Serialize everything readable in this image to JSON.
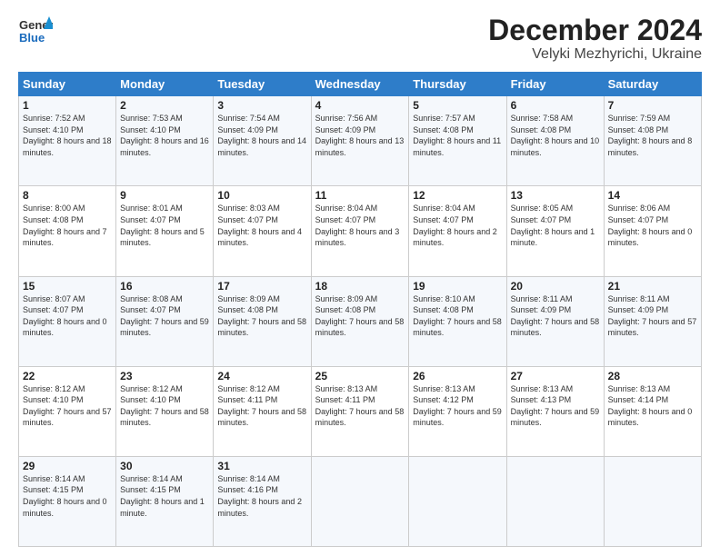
{
  "header": {
    "logo_line1": "General",
    "logo_line2": "Blue",
    "title": "December 2024",
    "subtitle": "Velyki Mezhyrichi, Ukraine"
  },
  "calendar": {
    "days_of_week": [
      "Sunday",
      "Monday",
      "Tuesday",
      "Wednesday",
      "Thursday",
      "Friday",
      "Saturday"
    ],
    "weeks": [
      [
        {
          "day": "1",
          "info": "Sunrise: 7:52 AM\nSunset: 4:10 PM\nDaylight: 8 hours and 18 minutes."
        },
        {
          "day": "2",
          "info": "Sunrise: 7:53 AM\nSunset: 4:10 PM\nDaylight: 8 hours and 16 minutes."
        },
        {
          "day": "3",
          "info": "Sunrise: 7:54 AM\nSunset: 4:09 PM\nDaylight: 8 hours and 14 minutes."
        },
        {
          "day": "4",
          "info": "Sunrise: 7:56 AM\nSunset: 4:09 PM\nDaylight: 8 hours and 13 minutes."
        },
        {
          "day": "5",
          "info": "Sunrise: 7:57 AM\nSunset: 4:08 PM\nDaylight: 8 hours and 11 minutes."
        },
        {
          "day": "6",
          "info": "Sunrise: 7:58 AM\nSunset: 4:08 PM\nDaylight: 8 hours and 10 minutes."
        },
        {
          "day": "7",
          "info": "Sunrise: 7:59 AM\nSunset: 4:08 PM\nDaylight: 8 hours and 8 minutes."
        }
      ],
      [
        {
          "day": "8",
          "info": "Sunrise: 8:00 AM\nSunset: 4:08 PM\nDaylight: 8 hours and 7 minutes."
        },
        {
          "day": "9",
          "info": "Sunrise: 8:01 AM\nSunset: 4:07 PM\nDaylight: 8 hours and 5 minutes."
        },
        {
          "day": "10",
          "info": "Sunrise: 8:03 AM\nSunset: 4:07 PM\nDaylight: 8 hours and 4 minutes."
        },
        {
          "day": "11",
          "info": "Sunrise: 8:04 AM\nSunset: 4:07 PM\nDaylight: 8 hours and 3 minutes."
        },
        {
          "day": "12",
          "info": "Sunrise: 8:04 AM\nSunset: 4:07 PM\nDaylight: 8 hours and 2 minutes."
        },
        {
          "day": "13",
          "info": "Sunrise: 8:05 AM\nSunset: 4:07 PM\nDaylight: 8 hours and 1 minute."
        },
        {
          "day": "14",
          "info": "Sunrise: 8:06 AM\nSunset: 4:07 PM\nDaylight: 8 hours and 0 minutes."
        }
      ],
      [
        {
          "day": "15",
          "info": "Sunrise: 8:07 AM\nSunset: 4:07 PM\nDaylight: 8 hours and 0 minutes."
        },
        {
          "day": "16",
          "info": "Sunrise: 8:08 AM\nSunset: 4:07 PM\nDaylight: 7 hours and 59 minutes."
        },
        {
          "day": "17",
          "info": "Sunrise: 8:09 AM\nSunset: 4:08 PM\nDaylight: 7 hours and 58 minutes."
        },
        {
          "day": "18",
          "info": "Sunrise: 8:09 AM\nSunset: 4:08 PM\nDaylight: 7 hours and 58 minutes."
        },
        {
          "day": "19",
          "info": "Sunrise: 8:10 AM\nSunset: 4:08 PM\nDaylight: 7 hours and 58 minutes."
        },
        {
          "day": "20",
          "info": "Sunrise: 8:11 AM\nSunset: 4:09 PM\nDaylight: 7 hours and 58 minutes."
        },
        {
          "day": "21",
          "info": "Sunrise: 8:11 AM\nSunset: 4:09 PM\nDaylight: 7 hours and 57 minutes."
        }
      ],
      [
        {
          "day": "22",
          "info": "Sunrise: 8:12 AM\nSunset: 4:10 PM\nDaylight: 7 hours and 57 minutes."
        },
        {
          "day": "23",
          "info": "Sunrise: 8:12 AM\nSunset: 4:10 PM\nDaylight: 7 hours and 58 minutes."
        },
        {
          "day": "24",
          "info": "Sunrise: 8:12 AM\nSunset: 4:11 PM\nDaylight: 7 hours and 58 minutes."
        },
        {
          "day": "25",
          "info": "Sunrise: 8:13 AM\nSunset: 4:11 PM\nDaylight: 7 hours and 58 minutes."
        },
        {
          "day": "26",
          "info": "Sunrise: 8:13 AM\nSunset: 4:12 PM\nDaylight: 7 hours and 59 minutes."
        },
        {
          "day": "27",
          "info": "Sunrise: 8:13 AM\nSunset: 4:13 PM\nDaylight: 7 hours and 59 minutes."
        },
        {
          "day": "28",
          "info": "Sunrise: 8:13 AM\nSunset: 4:14 PM\nDaylight: 8 hours and 0 minutes."
        }
      ],
      [
        {
          "day": "29",
          "info": "Sunrise: 8:14 AM\nSunset: 4:15 PM\nDaylight: 8 hours and 0 minutes."
        },
        {
          "day": "30",
          "info": "Sunrise: 8:14 AM\nSunset: 4:15 PM\nDaylight: 8 hours and 1 minute."
        },
        {
          "day": "31",
          "info": "Sunrise: 8:14 AM\nSunset: 4:16 PM\nDaylight: 8 hours and 2 minutes."
        },
        null,
        null,
        null,
        null
      ]
    ]
  }
}
